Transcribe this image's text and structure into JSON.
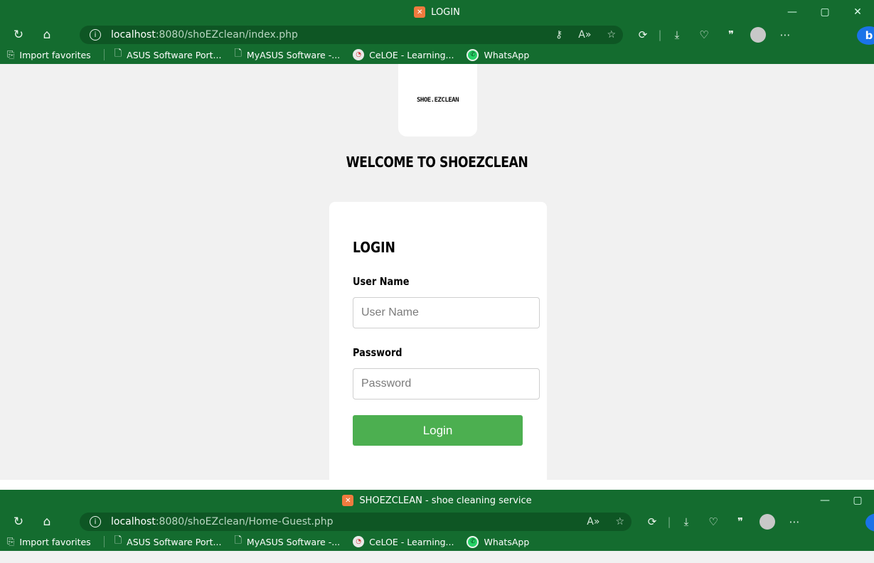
{
  "window1": {
    "title": "LOGIN",
    "url_host": "localhost",
    "url_path": ":8080/shoEZclean/index.php",
    "page": {
      "logo_text": "SHOE.EZCLEAN",
      "welcome_heading": "WELCOME TO SHOEZCLEAN",
      "form": {
        "title": "LOGIN",
        "username_label": "User Name",
        "username_placeholder": "User Name",
        "password_label": "Password",
        "password_placeholder": "Password",
        "submit_label": "Login"
      }
    }
  },
  "window2": {
    "title": "SHOEZCLEAN - shoe cleaning service",
    "url_host": "localhost",
    "url_path": ":8080/shoEZclean/Home-Guest.php"
  },
  "bookmarks": [
    {
      "label": "Import favorites"
    },
    {
      "label": "ASUS Software Port..."
    },
    {
      "label": "MyASUS Software -..."
    },
    {
      "label": "CeLOE - Learning..."
    },
    {
      "label": "WhatsApp"
    }
  ],
  "toolbar_icons": [
    "refresh-icon",
    "home-icon",
    "info-icon",
    "read-aloud-icon",
    "favorite-star-icon",
    "extensions-icon",
    "downloads-icon",
    "health-icon",
    "quotes-icon",
    "profile-avatar",
    "more-icon",
    "bing-copilot-icon"
  ],
  "colors": {
    "chrome": "#146c2f",
    "address_bar": "#0e5624",
    "page_bg": "#f1f1f1",
    "login_button": "#4caf50"
  }
}
